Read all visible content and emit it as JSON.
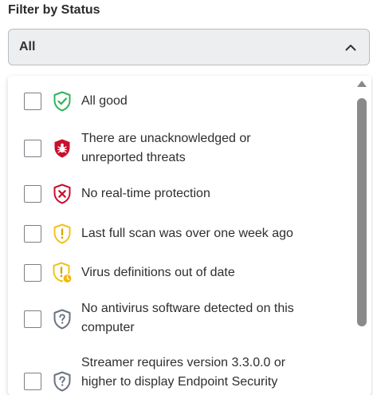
{
  "filter": {
    "label": "Filter by Status",
    "selected": "All"
  },
  "options": [
    {
      "label": "All good",
      "icon": "shield-check-icon"
    },
    {
      "label": "There are unacknowledged or unreported threats",
      "icon": "shield-bug-icon"
    },
    {
      "label": "No real-time protection",
      "icon": "shield-x-icon"
    },
    {
      "label": "Last full scan was over one week ago",
      "icon": "shield-exclamation-icon"
    },
    {
      "label": "Virus definitions out of date",
      "icon": "shield-exclamation-clock-icon"
    },
    {
      "label": "No antivirus software detected on this computer",
      "icon": "shield-question-icon"
    },
    {
      "label": "Streamer requires version 3.3.0.0 or higher to display Endpoint Security",
      "icon": "shield-question-icon"
    }
  ],
  "colors": {
    "ok": "#2fb55a",
    "danger": "#c8102e",
    "warning": "#f2c21b",
    "neutral": "#6b7280"
  }
}
